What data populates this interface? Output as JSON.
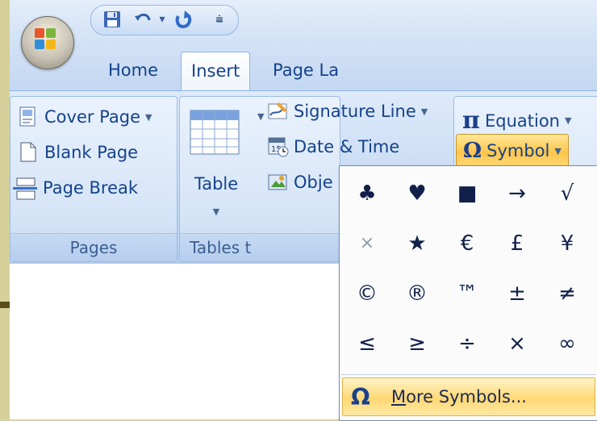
{
  "qat": {
    "dropdown_glyph": "▾",
    "customize_glyph": "⩧"
  },
  "tabs": [
    {
      "label": "Home",
      "active": false
    },
    {
      "label": "Insert",
      "active": true
    },
    {
      "label": "Page La",
      "active": false
    }
  ],
  "groups": {
    "pages": {
      "label": "Pages",
      "items": [
        "Cover Page",
        "Blank Page",
        "Page Break"
      ]
    },
    "tables": {
      "label": "Tables t",
      "table_button": "Table"
    },
    "text": {
      "signature_line": "Signature Line",
      "date_time": "Date & Time",
      "object": "Obje"
    },
    "symbols": {
      "equation": "Equation",
      "equation_icon": "π",
      "symbol": "Symbol",
      "symbol_icon": "Ω"
    }
  },
  "symbol_gallery": {
    "symbols": [
      "♣",
      "♥",
      "■",
      "→",
      "√",
      "×",
      "★",
      "€",
      "£",
      "¥",
      "©",
      "®",
      "™",
      "±",
      "≠",
      "≤",
      "≥",
      "÷",
      "×",
      "∞"
    ],
    "more_icon": "Ω",
    "more_label_underlined": "M",
    "more_label_rest": "ore Symbols..."
  },
  "colors": {
    "ribbon_text": "#15428b",
    "highlight": "#ffd874",
    "symbol_text": "#10204a"
  }
}
